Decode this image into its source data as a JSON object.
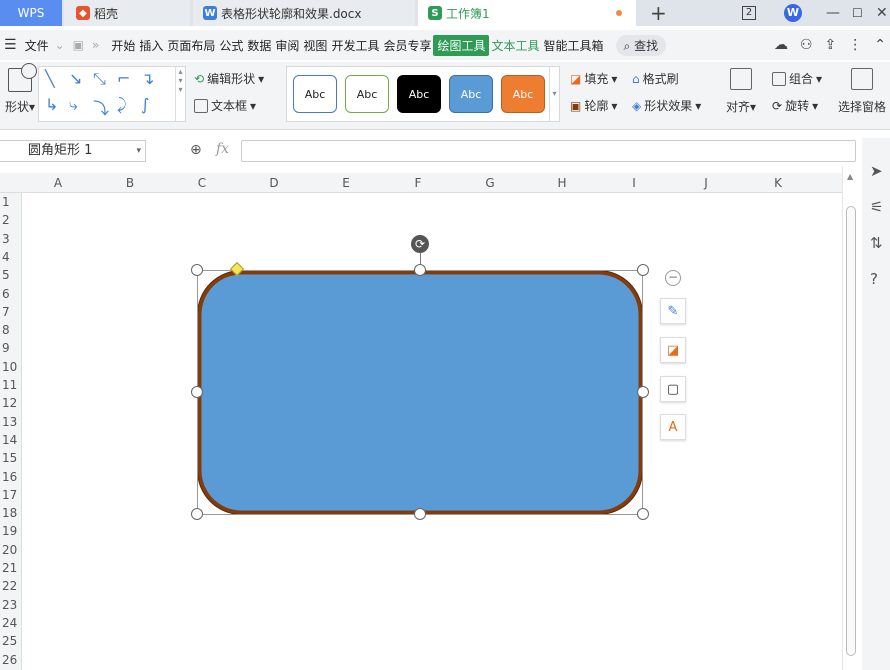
{
  "tabs": {
    "wps": "WPS",
    "daoke": "稻壳",
    "doc": "表格形状轮廓和效果.docx",
    "workbook": "工作簿1",
    "new_tab": "+"
  },
  "titlebar": {
    "badge": "2",
    "logo": "W"
  },
  "menubar": {
    "file": "文件",
    "items": [
      "开始",
      "插入",
      "页面布局",
      "公式",
      "数据",
      "审阅",
      "视图",
      "开发工具",
      "会员专享"
    ],
    "active": "绘图工具",
    "text_tools": "文本工具",
    "smart_tools": "智能工具箱",
    "search": "查找"
  },
  "ribbon": {
    "shape_label": "形状",
    "edit_shape": "编辑形状",
    "textbox": "文本框",
    "styles": [
      "Abc",
      "Abc",
      "Abc",
      "Abc",
      "Abc"
    ],
    "fill": "填充",
    "format_painter": "格式刷",
    "outline": "轮廓",
    "shape_effects": "形状效果",
    "align": "对齐",
    "group": "组合",
    "rotate": "旋转",
    "selection_pane": "选择窗格"
  },
  "formula_bar": {
    "name_box": "圆角矩形  1",
    "fx": "fx",
    "value": ""
  },
  "columns": [
    "A",
    "B",
    "C",
    "D",
    "E",
    "F",
    "G",
    "H",
    "I",
    "J",
    "K"
  ],
  "rows": [
    "1",
    "2",
    "3",
    "4",
    "5",
    "6",
    "7",
    "8",
    "9",
    "10",
    "11",
    "12",
    "13",
    "14",
    "15",
    "16",
    "17",
    "18",
    "19",
    "20",
    "21",
    "22",
    "23",
    "24",
    "25",
    "26"
  ],
  "colors": {
    "accent_green": "#2e9c55",
    "shape_fill": "#5b9bd5",
    "shape_outline": "#843c0c",
    "wps_blue": "#5a8df0"
  }
}
